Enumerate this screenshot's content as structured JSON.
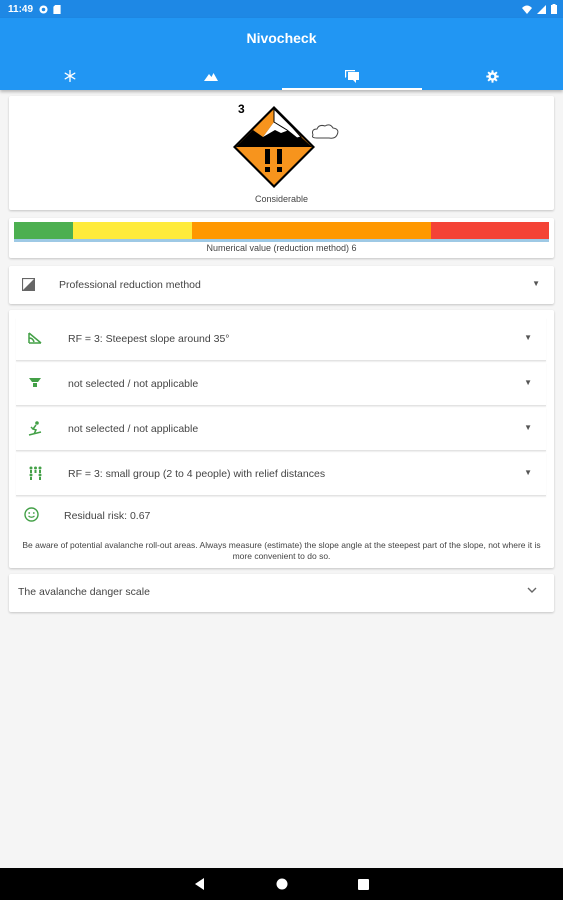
{
  "status_bar": {
    "time": "11:49"
  },
  "app": {
    "title": "Nivocheck"
  },
  "tabs": [
    {
      "icon": "snowflake-icon"
    },
    {
      "icon": "mountain-icon"
    },
    {
      "icon": "chat-icon",
      "active": true
    },
    {
      "icon": "gear-icon"
    }
  ],
  "danger": {
    "level": "3",
    "label": "Considerable"
  },
  "scale": {
    "text": "Numerical value (reduction method) 6",
    "colors": [
      "#4caf50",
      "#ffeb3b",
      "#ff9800",
      "#f44336"
    ]
  },
  "method": {
    "label": "Professional reduction method"
  },
  "factors": [
    {
      "icon": "slope-icon",
      "label": "RF = 3: Steepest slope around 35°"
    },
    {
      "icon": "aspect-icon",
      "label": "not selected / not applicable"
    },
    {
      "icon": "skier-icon",
      "label": "not selected / not applicable"
    },
    {
      "icon": "group-icon",
      "label": "RF = 3: small group (2 to 4 people) with relief distances"
    }
  ],
  "residual": {
    "label": "Residual risk: 0.67"
  },
  "note": "Be aware of potential avalanche roll-out areas. Always measure (estimate) the slope angle at the steepest part of the slope, not where it is more convenient to do so.",
  "danger_scale": {
    "label": "The avalanche danger scale"
  }
}
